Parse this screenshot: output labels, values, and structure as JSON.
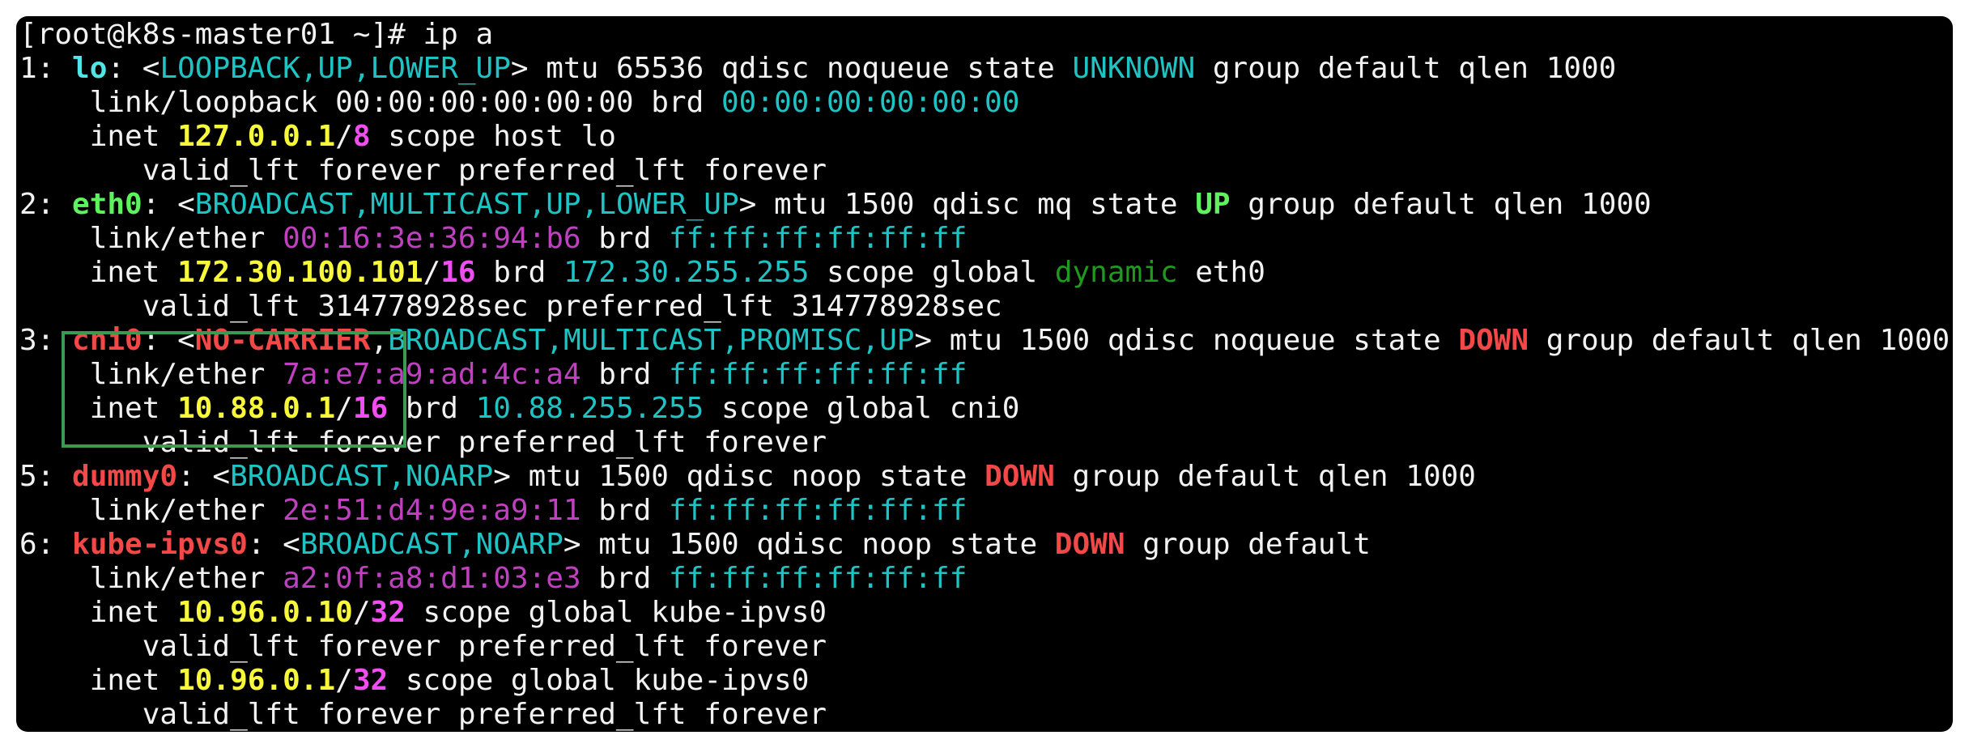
{
  "terminal": {
    "colors": {
      "default": "#f2f2f2",
      "cyan": "#1fc3c3",
      "cyan_bold": "#52e5e5",
      "yellow": "#f7f73b",
      "magenta": "#f04ef0",
      "magenta_dim": "#c041c0",
      "green": "#5ef25e",
      "green_dim": "#1f9a1f",
      "red": "#f24848",
      "highlight_box": "#3a9a52"
    },
    "lines": [
      [
        {
          "t": "[root@k8s-master01 ~]# ip a",
          "c": "default"
        }
      ],
      [
        {
          "t": "1: ",
          "c": "default"
        },
        {
          "t": "lo",
          "c": "cyan_bold",
          "b": true
        },
        {
          "t": ": <",
          "c": "default"
        },
        {
          "t": "LOOPBACK,UP,LOWER_UP",
          "c": "cyan"
        },
        {
          "t": "> mtu 65536 qdisc noqueue state ",
          "c": "default"
        },
        {
          "t": "UNKNOWN",
          "c": "cyan"
        },
        {
          "t": " group default qlen 1000",
          "c": "default"
        }
      ],
      [
        {
          "t": "    link/loopback 00:00:00:00:00:00 brd ",
          "c": "default"
        },
        {
          "t": "00:00:00:00:00:00",
          "c": "cyan"
        }
      ],
      [
        {
          "t": "    inet ",
          "c": "default"
        },
        {
          "t": "127.0.0.1",
          "c": "yellow",
          "b": true
        },
        {
          "t": "/",
          "c": "default"
        },
        {
          "t": "8",
          "c": "magenta",
          "b": true
        },
        {
          "t": " scope host lo",
          "c": "default"
        }
      ],
      [
        {
          "t": "       valid_lft forever preferred_lft forever",
          "c": "default"
        }
      ],
      [
        {
          "t": "2: ",
          "c": "default"
        },
        {
          "t": "eth0",
          "c": "green",
          "b": true
        },
        {
          "t": ": <",
          "c": "default"
        },
        {
          "t": "BROADCAST,MULTICAST,UP,LOWER_UP",
          "c": "cyan"
        },
        {
          "t": "> mtu 1500 qdisc mq state ",
          "c": "default"
        },
        {
          "t": "UP",
          "c": "green",
          "b": true
        },
        {
          "t": " group default qlen 1000",
          "c": "default"
        }
      ],
      [
        {
          "t": "    link/ether ",
          "c": "default"
        },
        {
          "t": "00:16:3e:36:94:b6",
          "c": "magenta_dim"
        },
        {
          "t": " brd ",
          "c": "default"
        },
        {
          "t": "ff:ff:ff:ff:ff:ff",
          "c": "cyan"
        }
      ],
      [
        {
          "t": "    inet ",
          "c": "default"
        },
        {
          "t": "172.30.100.101",
          "c": "yellow",
          "b": true
        },
        {
          "t": "/",
          "c": "default"
        },
        {
          "t": "16",
          "c": "magenta",
          "b": true
        },
        {
          "t": " brd ",
          "c": "default"
        },
        {
          "t": "172.30.255.255",
          "c": "cyan"
        },
        {
          "t": " scope global ",
          "c": "default"
        },
        {
          "t": "dynamic",
          "c": "green_dim"
        },
        {
          "t": " eth0",
          "c": "default"
        }
      ],
      [
        {
          "t": "       valid_lft 314778928sec preferred_lft 314778928sec",
          "c": "default"
        }
      ],
      [
        {
          "t": "3: ",
          "c": "default"
        },
        {
          "t": "cni0",
          "c": "red",
          "b": true
        },
        {
          "t": ": <",
          "c": "default"
        },
        {
          "t": "NO-CARRIER",
          "c": "red",
          "b": true
        },
        {
          "t": ",",
          "c": "default"
        },
        {
          "t": "BROADCAST,MULTICAST,PROMISC,UP",
          "c": "cyan"
        },
        {
          "t": "> mtu 1500 qdisc noqueue state ",
          "c": "default"
        },
        {
          "t": "DOWN",
          "c": "red",
          "b": true
        },
        {
          "t": " group default qlen 1000",
          "c": "default"
        }
      ],
      [
        {
          "t": "    link/ether ",
          "c": "default"
        },
        {
          "t": "7a:e7:a9:ad:4c:a4",
          "c": "magenta_dim"
        },
        {
          "t": " brd ",
          "c": "default"
        },
        {
          "t": "ff:ff:ff:ff:ff:ff",
          "c": "cyan"
        }
      ],
      [
        {
          "t": "    inet ",
          "c": "default"
        },
        {
          "t": "10.88.0.1",
          "c": "yellow",
          "b": true
        },
        {
          "t": "/",
          "c": "default"
        },
        {
          "t": "16",
          "c": "magenta",
          "b": true
        },
        {
          "t": " brd ",
          "c": "default"
        },
        {
          "t": "10.88.255.255",
          "c": "cyan"
        },
        {
          "t": " scope global cni0",
          "c": "default"
        }
      ],
      [
        {
          "t": "       valid_lft forever preferred_lft forever",
          "c": "default"
        }
      ],
      [
        {
          "t": "5: ",
          "c": "default"
        },
        {
          "t": "dummy0",
          "c": "red",
          "b": true
        },
        {
          "t": ": <",
          "c": "default"
        },
        {
          "t": "BROADCAST,NOARP",
          "c": "cyan"
        },
        {
          "t": "> mtu 1500 qdisc noop state ",
          "c": "default"
        },
        {
          "t": "DOWN",
          "c": "red",
          "b": true
        },
        {
          "t": " group default qlen 1000",
          "c": "default"
        }
      ],
      [
        {
          "t": "    link/ether ",
          "c": "default"
        },
        {
          "t": "2e:51:d4:9e:a9:11",
          "c": "magenta_dim"
        },
        {
          "t": " brd ",
          "c": "default"
        },
        {
          "t": "ff:ff:ff:ff:ff:ff",
          "c": "cyan"
        }
      ],
      [
        {
          "t": "6: ",
          "c": "default"
        },
        {
          "t": "kube-ipvs0",
          "c": "red",
          "b": true
        },
        {
          "t": ": <",
          "c": "default"
        },
        {
          "t": "BROADCAST,NOARP",
          "c": "cyan"
        },
        {
          "t": "> mtu 1500 qdisc noop state ",
          "c": "default"
        },
        {
          "t": "DOWN",
          "c": "red",
          "b": true
        },
        {
          "t": " group default",
          "c": "default"
        }
      ],
      [
        {
          "t": "    link/ether ",
          "c": "default"
        },
        {
          "t": "a2:0f:a8:d1:03:e3",
          "c": "magenta_dim"
        },
        {
          "t": " brd ",
          "c": "default"
        },
        {
          "t": "ff:ff:ff:ff:ff:ff",
          "c": "cyan"
        }
      ],
      [
        {
          "t": "    inet ",
          "c": "default"
        },
        {
          "t": "10.96.0.10",
          "c": "yellow",
          "b": true
        },
        {
          "t": "/",
          "c": "default"
        },
        {
          "t": "32",
          "c": "magenta",
          "b": true
        },
        {
          "t": " scope global kube-ipvs0",
          "c": "default"
        }
      ],
      [
        {
          "t": "       valid_lft forever preferred_lft forever",
          "c": "default"
        }
      ],
      [
        {
          "t": "    inet ",
          "c": "default"
        },
        {
          "t": "10.96.0.1",
          "c": "yellow",
          "b": true
        },
        {
          "t": "/",
          "c": "default"
        },
        {
          "t": "32",
          "c": "magenta",
          "b": true
        },
        {
          "t": " scope global kube-ipvs0",
          "c": "default"
        }
      ],
      [
        {
          "t": "       valid_lft forever preferred_lft forever",
          "c": "default"
        }
      ]
    ]
  }
}
